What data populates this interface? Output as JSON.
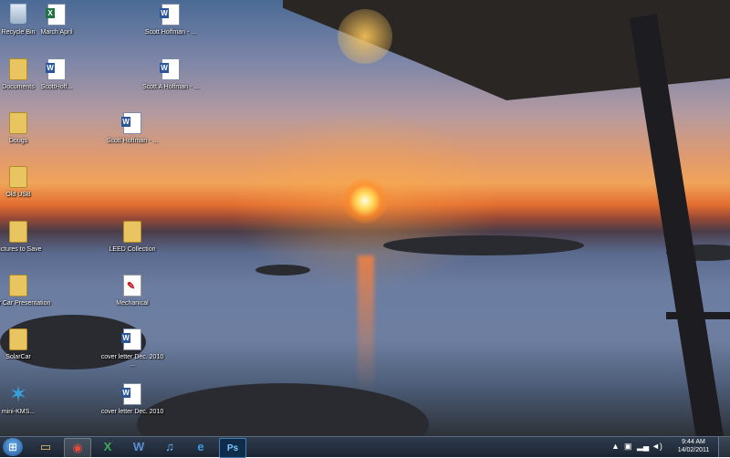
{
  "desktop": {
    "icons": [
      {
        "label": "Recycle Bin",
        "icon": "recycle-bin-icon"
      },
      {
        "label": "March April",
        "icon": "excel-file-icon"
      },
      {
        "label": "Scott Hoffman - ...",
        "icon": "word-file-icon"
      },
      {
        "label": "Documents",
        "icon": "folder-icon"
      },
      {
        "label": "ScottHoff...",
        "icon": "word-file-icon"
      },
      {
        "label": "Scott A Hoffman - ...",
        "icon": "word-file-icon"
      },
      {
        "label": "Dougs",
        "icon": "folder-icon"
      },
      {
        "label": "Scott Hoffman - ...",
        "icon": "word-file-icon"
      },
      {
        "label": "Old USB",
        "icon": "folder-icon"
      },
      {
        "label": "Pictures to Save",
        "icon": "folder-icon"
      },
      {
        "label": "LEED Collection",
        "icon": "folder-icon"
      },
      {
        "label": "Solar Car Presentation",
        "icon": "folder-icon"
      },
      {
        "label": "Mechanical",
        "icon": "pdf-file-icon"
      },
      {
        "label": "SolarCar",
        "icon": "folder-icon"
      },
      {
        "label": "cover letter Dec. 2010 ...",
        "icon": "word-file-icon"
      },
      {
        "label": "mini-KMS...",
        "icon": "star-app-icon"
      },
      {
        "label": "cover letter Dec. 2010",
        "icon": "word-file-icon"
      }
    ]
  },
  "taskbar": {
    "pinned": [
      {
        "icon": "file-explorer-icon",
        "glyph": "▭"
      },
      {
        "icon": "chrome-icon",
        "glyph": "◉"
      },
      {
        "icon": "excel-icon",
        "glyph": "X"
      },
      {
        "icon": "word-icon",
        "glyph": "W"
      },
      {
        "icon": "itunes-icon",
        "glyph": "♫"
      },
      {
        "icon": "internet-explorer-icon",
        "glyph": "e"
      },
      {
        "icon": "photoshop-icon",
        "glyph": "Ps"
      }
    ],
    "clock": {
      "time": "9:44 AM",
      "date": "14/02/2011"
    }
  },
  "colors": {
    "taskbar": "#1b2431",
    "sun": "#ffdb5a"
  }
}
